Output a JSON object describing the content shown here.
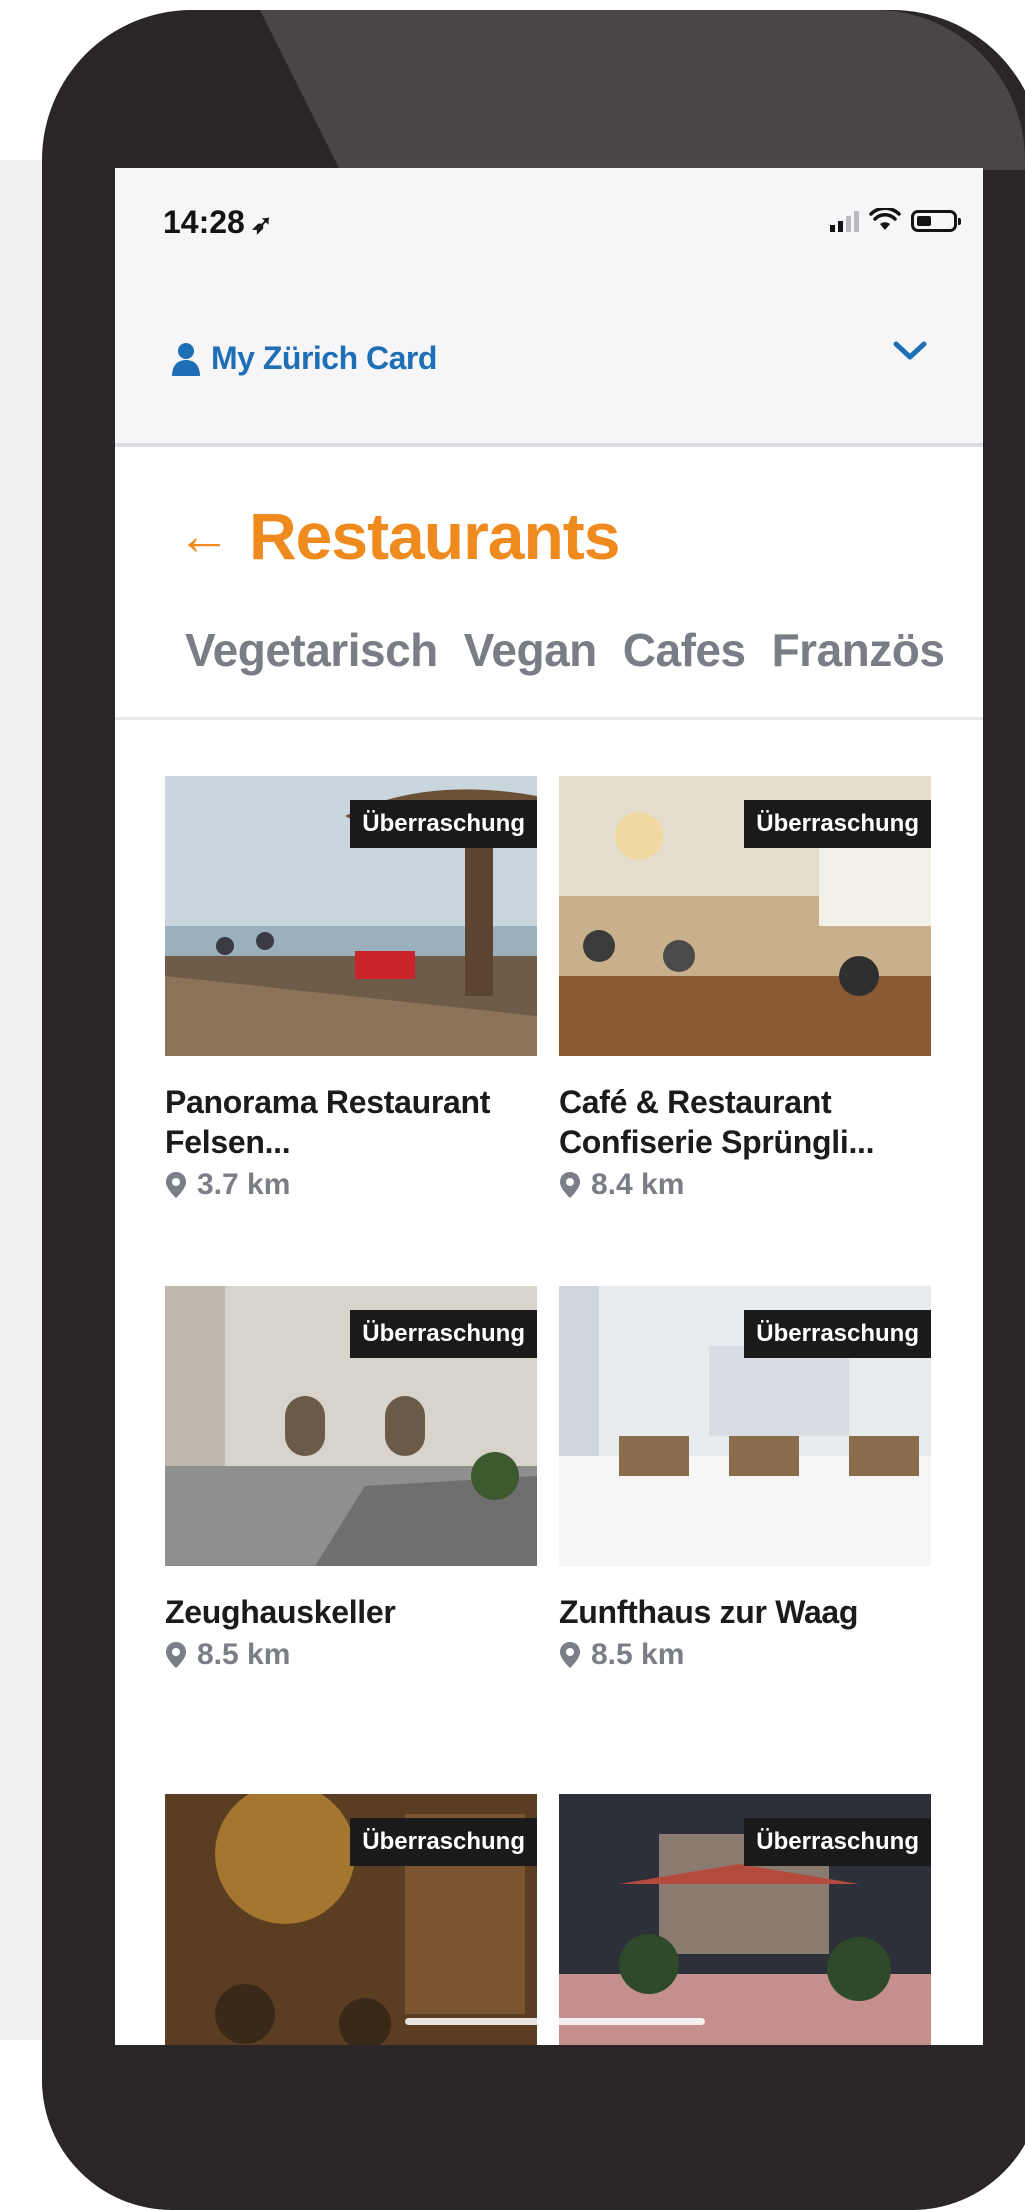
{
  "status_bar": {
    "time": "14:28"
  },
  "header": {
    "account_label": "My Zürich Card"
  },
  "page": {
    "title": "Restaurants"
  },
  "tabs": [
    "Vegetarisch",
    "Vegan",
    "Cafes",
    "Französ"
  ],
  "restaurants": [
    {
      "name": "Panorama Restaurant Felsen...",
      "distance": "3.7 km",
      "badge": "Überraschung"
    },
    {
      "name": "Café & Restaurant Confiserie Sprüngli...",
      "distance": "8.4 km",
      "badge": "Überraschung"
    },
    {
      "name": "Zeughauskeller",
      "distance": "8.5 km",
      "badge": "Überraschung"
    },
    {
      "name": "Zunfthaus zur Waag",
      "distance": "8.5 km",
      "badge": "Überraschung"
    },
    {
      "name": "",
      "distance": "",
      "badge": "Überraschung"
    },
    {
      "name": "",
      "distance": "",
      "badge": "Überraschung"
    }
  ],
  "colors": {
    "accent": "#ef8a1e",
    "link_blue": "#1e6fb5",
    "badge_bg": "#1a1a1a",
    "muted_text": "#7a7d85",
    "phone_frame": "#2a2627"
  },
  "icons": [
    "location-arrow-icon",
    "signal-icon",
    "wifi-icon",
    "battery-icon",
    "user-icon",
    "chevron-down-icon",
    "back-arrow-icon",
    "map-pin-icon"
  ]
}
